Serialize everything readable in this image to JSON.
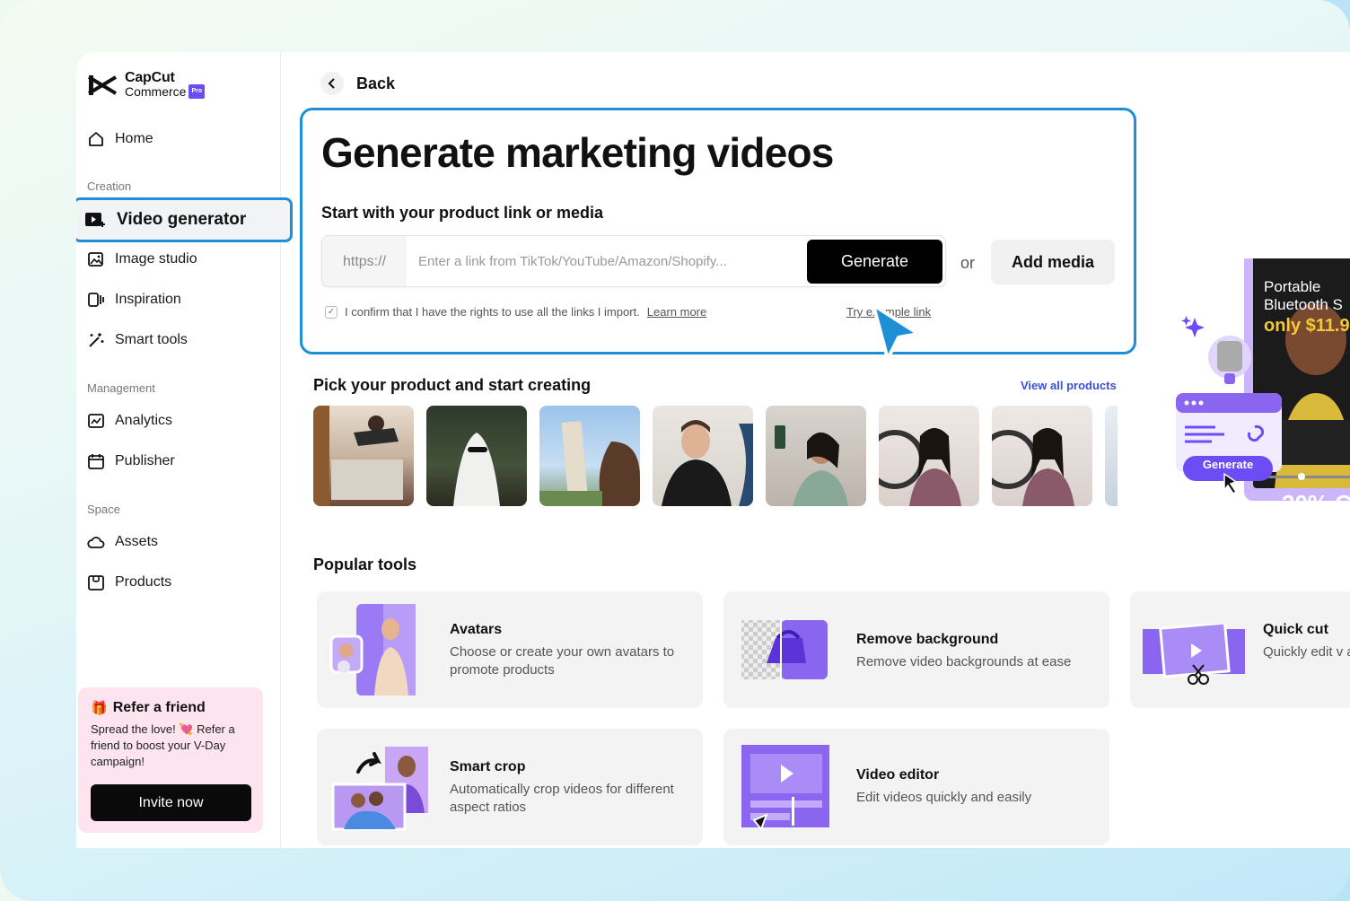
{
  "brand": {
    "line1": "CapCut",
    "line2": "Commerce",
    "badge": "Pro"
  },
  "sidebar": {
    "home": "Home",
    "creation_label": "Creation",
    "video_generator": "Video generator",
    "image_studio": "Image studio",
    "inspiration": "Inspiration",
    "smart_tools": "Smart tools",
    "management_label": "Management",
    "analytics": "Analytics",
    "publisher": "Publisher",
    "space_label": "Space",
    "assets": "Assets",
    "products": "Products"
  },
  "refer": {
    "title": "Refer a friend",
    "body": "Spread the love! 💘 Refer a friend to boost your V-Day campaign!",
    "button": "Invite now"
  },
  "main": {
    "back": "Back",
    "title": "Generate marketing videos",
    "subtitle": "Start with your product link or media",
    "url_prefix": "https://",
    "url_placeholder": "Enter a link from TikTok/YouTube/Amazon/Shopify...",
    "generate": "Generate",
    "or": "or",
    "add_media": "Add media",
    "confirm_text": "I confirm that I have the rights to use all the links I import.",
    "learn_more": "Learn more",
    "try_link": "Try example link",
    "pick_title": "Pick your product and start creating",
    "view_all": "View all products",
    "popular_title": "Popular tools"
  },
  "tools": [
    {
      "name": "Avatars",
      "desc": "Choose or create your own avatars to promote products"
    },
    {
      "name": "Remove background",
      "desc": "Remove video backgrounds at ease"
    },
    {
      "name": "Quick cut",
      "desc": "Quickly edit v and editing te"
    },
    {
      "name": "Smart crop",
      "desc": "Automatically crop videos for different aspect ratios"
    },
    {
      "name": "Video editor",
      "desc": "Edit videos quickly and easily"
    }
  ],
  "promo": {
    "line1": "Portable",
    "line2": "Bluetooth S",
    "price": "only $11.9",
    "generate": "Generate",
    "discount": "30% C"
  },
  "colors": {
    "accent": "#1e8fd6",
    "purple": "#7b5cf0",
    "link": "#3b4fd6"
  }
}
